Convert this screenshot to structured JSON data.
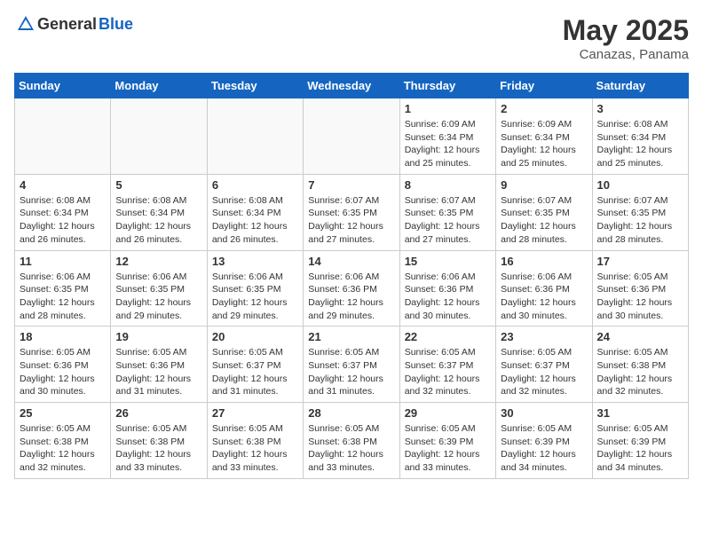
{
  "header": {
    "logo_general": "General",
    "logo_blue": "Blue",
    "month": "May 2025",
    "location": "Canazas, Panama"
  },
  "weekdays": [
    "Sunday",
    "Monday",
    "Tuesday",
    "Wednesday",
    "Thursday",
    "Friday",
    "Saturday"
  ],
  "weeks": [
    [
      {
        "day": "",
        "info": ""
      },
      {
        "day": "",
        "info": ""
      },
      {
        "day": "",
        "info": ""
      },
      {
        "day": "",
        "info": ""
      },
      {
        "day": "1",
        "info": "Sunrise: 6:09 AM\nSunset: 6:34 PM\nDaylight: 12 hours\nand 25 minutes."
      },
      {
        "day": "2",
        "info": "Sunrise: 6:09 AM\nSunset: 6:34 PM\nDaylight: 12 hours\nand 25 minutes."
      },
      {
        "day": "3",
        "info": "Sunrise: 6:08 AM\nSunset: 6:34 PM\nDaylight: 12 hours\nand 25 minutes."
      }
    ],
    [
      {
        "day": "4",
        "info": "Sunrise: 6:08 AM\nSunset: 6:34 PM\nDaylight: 12 hours\nand 26 minutes."
      },
      {
        "day": "5",
        "info": "Sunrise: 6:08 AM\nSunset: 6:34 PM\nDaylight: 12 hours\nand 26 minutes."
      },
      {
        "day": "6",
        "info": "Sunrise: 6:08 AM\nSunset: 6:34 PM\nDaylight: 12 hours\nand 26 minutes."
      },
      {
        "day": "7",
        "info": "Sunrise: 6:07 AM\nSunset: 6:35 PM\nDaylight: 12 hours\nand 27 minutes."
      },
      {
        "day": "8",
        "info": "Sunrise: 6:07 AM\nSunset: 6:35 PM\nDaylight: 12 hours\nand 27 minutes."
      },
      {
        "day": "9",
        "info": "Sunrise: 6:07 AM\nSunset: 6:35 PM\nDaylight: 12 hours\nand 28 minutes."
      },
      {
        "day": "10",
        "info": "Sunrise: 6:07 AM\nSunset: 6:35 PM\nDaylight: 12 hours\nand 28 minutes."
      }
    ],
    [
      {
        "day": "11",
        "info": "Sunrise: 6:06 AM\nSunset: 6:35 PM\nDaylight: 12 hours\nand 28 minutes."
      },
      {
        "day": "12",
        "info": "Sunrise: 6:06 AM\nSunset: 6:35 PM\nDaylight: 12 hours\nand 29 minutes."
      },
      {
        "day": "13",
        "info": "Sunrise: 6:06 AM\nSunset: 6:35 PM\nDaylight: 12 hours\nand 29 minutes."
      },
      {
        "day": "14",
        "info": "Sunrise: 6:06 AM\nSunset: 6:36 PM\nDaylight: 12 hours\nand 29 minutes."
      },
      {
        "day": "15",
        "info": "Sunrise: 6:06 AM\nSunset: 6:36 PM\nDaylight: 12 hours\nand 30 minutes."
      },
      {
        "day": "16",
        "info": "Sunrise: 6:06 AM\nSunset: 6:36 PM\nDaylight: 12 hours\nand 30 minutes."
      },
      {
        "day": "17",
        "info": "Sunrise: 6:05 AM\nSunset: 6:36 PM\nDaylight: 12 hours\nand 30 minutes."
      }
    ],
    [
      {
        "day": "18",
        "info": "Sunrise: 6:05 AM\nSunset: 6:36 PM\nDaylight: 12 hours\nand 30 minutes."
      },
      {
        "day": "19",
        "info": "Sunrise: 6:05 AM\nSunset: 6:36 PM\nDaylight: 12 hours\nand 31 minutes."
      },
      {
        "day": "20",
        "info": "Sunrise: 6:05 AM\nSunset: 6:37 PM\nDaylight: 12 hours\nand 31 minutes."
      },
      {
        "day": "21",
        "info": "Sunrise: 6:05 AM\nSunset: 6:37 PM\nDaylight: 12 hours\nand 31 minutes."
      },
      {
        "day": "22",
        "info": "Sunrise: 6:05 AM\nSunset: 6:37 PM\nDaylight: 12 hours\nand 32 minutes."
      },
      {
        "day": "23",
        "info": "Sunrise: 6:05 AM\nSunset: 6:37 PM\nDaylight: 12 hours\nand 32 minutes."
      },
      {
        "day": "24",
        "info": "Sunrise: 6:05 AM\nSunset: 6:38 PM\nDaylight: 12 hours\nand 32 minutes."
      }
    ],
    [
      {
        "day": "25",
        "info": "Sunrise: 6:05 AM\nSunset: 6:38 PM\nDaylight: 12 hours\nand 32 minutes."
      },
      {
        "day": "26",
        "info": "Sunrise: 6:05 AM\nSunset: 6:38 PM\nDaylight: 12 hours\nand 33 minutes."
      },
      {
        "day": "27",
        "info": "Sunrise: 6:05 AM\nSunset: 6:38 PM\nDaylight: 12 hours\nand 33 minutes."
      },
      {
        "day": "28",
        "info": "Sunrise: 6:05 AM\nSunset: 6:38 PM\nDaylight: 12 hours\nand 33 minutes."
      },
      {
        "day": "29",
        "info": "Sunrise: 6:05 AM\nSunset: 6:39 PM\nDaylight: 12 hours\nand 33 minutes."
      },
      {
        "day": "30",
        "info": "Sunrise: 6:05 AM\nSunset: 6:39 PM\nDaylight: 12 hours\nand 34 minutes."
      },
      {
        "day": "31",
        "info": "Sunrise: 6:05 AM\nSunset: 6:39 PM\nDaylight: 12 hours\nand 34 minutes."
      }
    ]
  ]
}
